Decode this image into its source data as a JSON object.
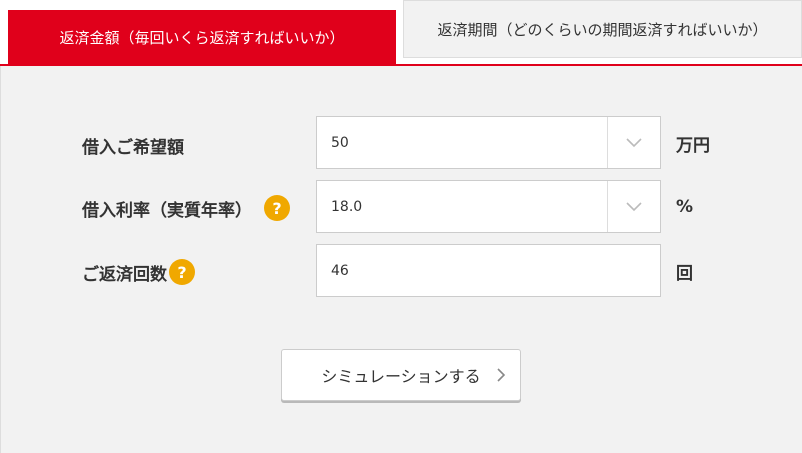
{
  "tabs": {
    "active_label": "返済金額（毎回いくら返済すればいいか）",
    "inactive_label": "返済期間（どのくらいの期間返済すればいいか）"
  },
  "form": {
    "loan_amount": {
      "label": "借入ご希望額",
      "value": "50",
      "unit": "万円"
    },
    "interest_rate": {
      "label": "借入利率（実質年率）",
      "value": "18.0",
      "unit": "%",
      "help": "?"
    },
    "repayment_count": {
      "label": "ご返済回数",
      "value": "46",
      "unit": "回",
      "help": "?"
    }
  },
  "button": {
    "label": "シミュレーションする"
  },
  "colors": {
    "accent": "#e0001b",
    "help": "#f0a800",
    "panel": "#f2f2f2"
  },
  "icons": {
    "select_caret": "chevron-down-icon",
    "button_arrow": "chevron-right-icon"
  }
}
